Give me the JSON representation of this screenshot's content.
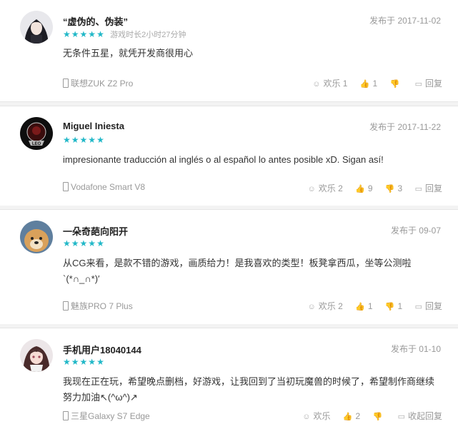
{
  "colors": {
    "star": "#22b8c8",
    "meta": "#999999",
    "separator": "#f3f3f3"
  },
  "reviews": [
    {
      "name": "“虚伪的、伪装”",
      "date": "发布于 2017-11-02",
      "stars": 5,
      "playtime": "游戏时长2小时27分钟",
      "content": "无条件五星，就凭开发商很用心",
      "device": "联想ZUK Z2 Pro",
      "fun_label": "欢乐 1",
      "like_count": "1",
      "dislike_count": "",
      "reply_label": "回复"
    },
    {
      "name": "Miguel Iniesta",
      "date": "发布于 2017-11-22",
      "stars": 5,
      "playtime": "",
      "content": "impresionante traducción al inglés o al español lo antes posible xD. Sigan así!",
      "device": "Vodafone Smart V8",
      "fun_label": "欢乐 2",
      "like_count": "9",
      "dislike_count": "3",
      "reply_label": "回复"
    },
    {
      "name": "一朵奇葩向阳开",
      "date": "发布于 09-07",
      "stars": 5,
      "playtime": "",
      "content": "从CG来看，是款不错的游戏，画质给力！是我喜欢的类型！板凳拿西瓜，坐等公测啦 `(*∩_∩*)′",
      "device": "魅族PRO 7 Plus",
      "fun_label": "欢乐 2",
      "like_count": "1",
      "dislike_count": "1",
      "reply_label": "回复"
    },
    {
      "name": "手机用户18040144",
      "date": "发布于 01-10",
      "stars": 5,
      "playtime": "",
      "content": "我现在正在玩，希望晚点删档，好游戏，让我回到了当初玩魔兽的时候了，希望制作商继续努力加油↖(^ω^)↗",
      "device": "三星Galaxy S7 Edge",
      "fun_label": "欢乐",
      "like_count": "2",
      "dislike_count": "",
      "reply_label": "收起回复"
    }
  ]
}
